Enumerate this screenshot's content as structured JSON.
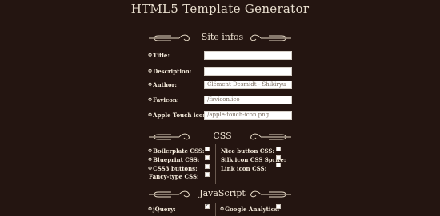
{
  "header": {
    "title": "HTML5 Template Generator"
  },
  "site_infos": {
    "heading": "Site infos",
    "fields": [
      {
        "label": "Title:",
        "value": ""
      },
      {
        "label": "Description:",
        "value": ""
      },
      {
        "label": "Author:",
        "value": "Clément Desmidt - Shikiryu"
      },
      {
        "label": "Favicon:",
        "value": "/favicon.ico"
      },
      {
        "label": "Apple Touch icon:",
        "value": "/apple-touch-icon.png"
      }
    ]
  },
  "css": {
    "heading": "CSS",
    "left": [
      {
        "label": "Boilerplate CSS:",
        "checked": false
      },
      {
        "label": "Blueprint CSS:",
        "checked": false
      },
      {
        "label": "CSS3 buttons:",
        "checked": false
      },
      {
        "label": "Fancy-type CSS:",
        "checked": false
      }
    ],
    "right": [
      {
        "label": "Nice button CSS:",
        "checked": false
      },
      {
        "label": "Silk icon CSS Sprite:",
        "checked": false
      },
      {
        "label": "Link icon CSS:",
        "checked": false
      }
    ]
  },
  "javascript": {
    "heading": "JavaScript",
    "left": [
      {
        "label": "jQuery:",
        "checked": true
      }
    ],
    "right": [
      {
        "label": "Google Analytics:",
        "checked": false
      }
    ]
  },
  "icons": {
    "field_marker": "pin-icon",
    "ornament": "flourish-ornament"
  },
  "colors": {
    "background": "#241511",
    "text": "#f1e7d6",
    "input_bg": "#ffffff"
  }
}
